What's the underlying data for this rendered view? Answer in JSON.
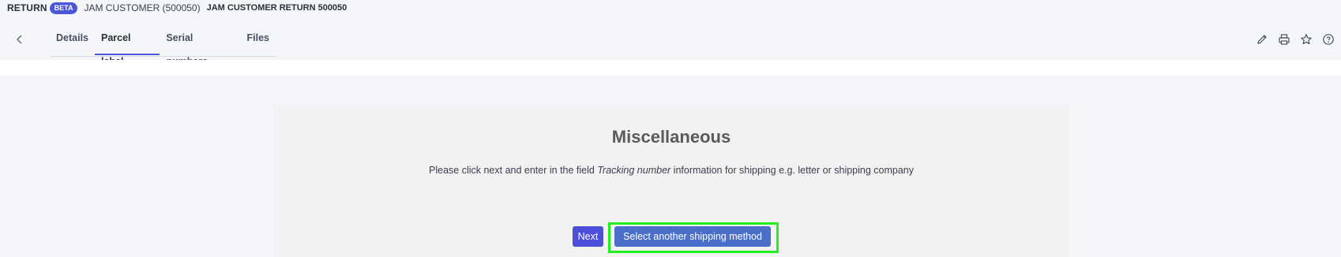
{
  "header": {
    "record_type": "RETURN",
    "badge": "BETA",
    "customer": "JAM CUSTOMER (500050)",
    "return_name": "JAM CUSTOMER RETURN 500050"
  },
  "tabs": [
    {
      "label": "Details",
      "active": false
    },
    {
      "label": "Parcel label",
      "active": true
    },
    {
      "label": "Serial numbers",
      "active": false
    },
    {
      "label": "Files",
      "active": false
    }
  ],
  "actions": [
    "pencil-icon",
    "printer-icon",
    "star-icon",
    "help-icon"
  ],
  "panel": {
    "title": "Miscellaneous",
    "text_before": "Please click next and enter in the field ",
    "text_italic": "Tracking number",
    "text_after": " information for shipping e.g. letter or shipping company"
  },
  "buttons": {
    "next": "Next",
    "select_other": "Select another shipping method"
  },
  "colors": {
    "accent": "#4b57d8",
    "next_button": "#4b4fd9",
    "select_button": "#4a6fca",
    "highlight": "#22ee22"
  }
}
